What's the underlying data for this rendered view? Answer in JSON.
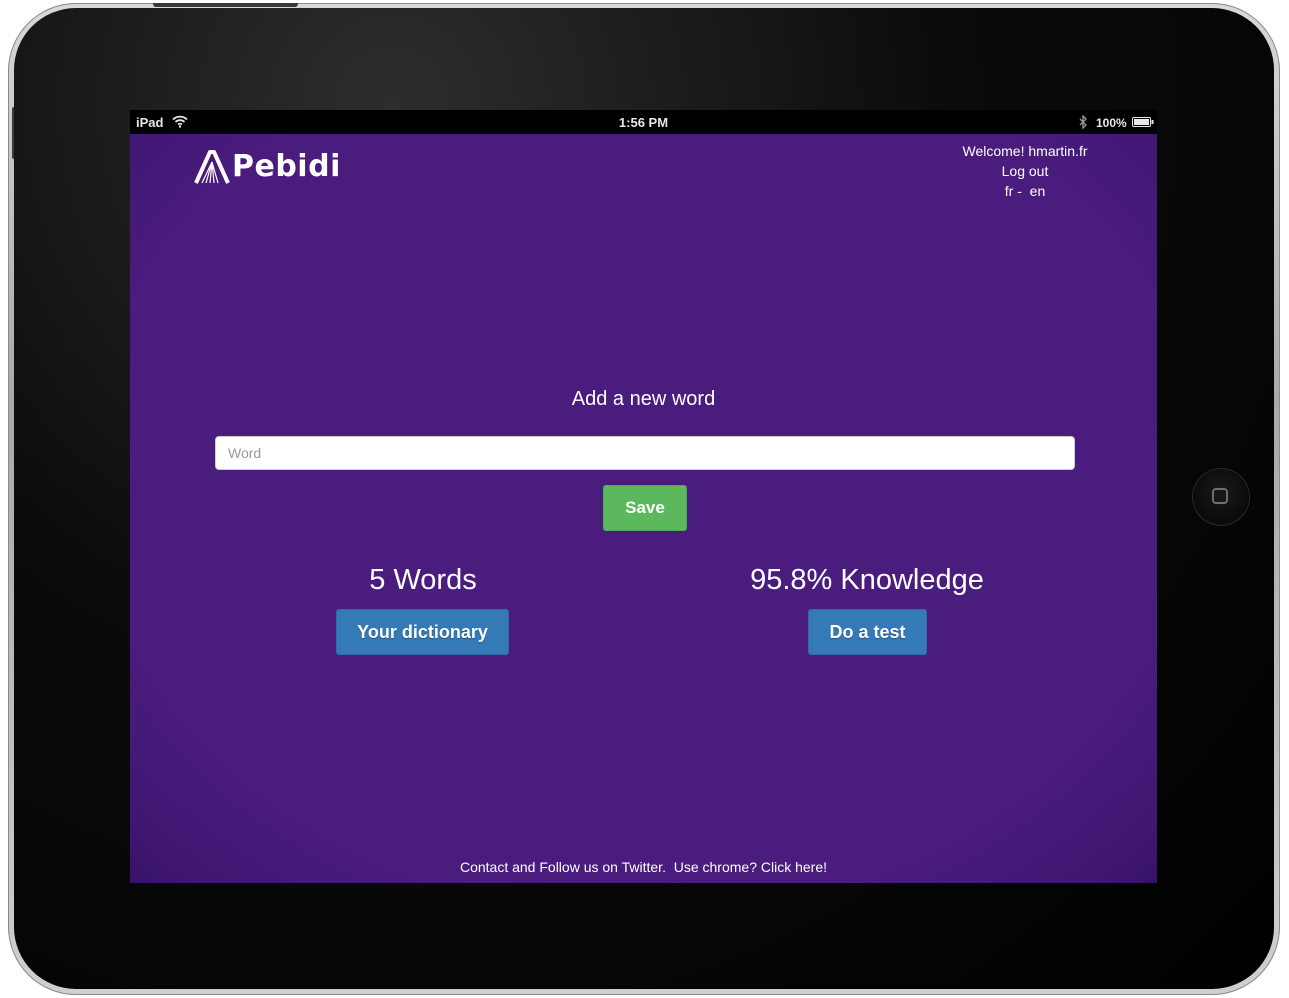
{
  "status_bar": {
    "device": "iPad",
    "time": "1:56 PM",
    "battery": "100%",
    "icons": [
      "wifi-icon",
      "bluetooth-icon",
      "battery-icon"
    ]
  },
  "header": {
    "logo_text": "Pebidi",
    "welcome": "Welcome! hmartin.fr",
    "logout": "Log out",
    "lang_fr": "fr",
    "lang_sep": " - ",
    "lang_en": "en"
  },
  "add_word": {
    "title": "Add a new word",
    "placeholder": "Word",
    "value": "",
    "save_label": "Save"
  },
  "stats": {
    "words": "5 Words",
    "dictionary_button": "Your dictionary",
    "knowledge": "95.8% Knowledge",
    "test_button": "Do a test"
  },
  "footer": {
    "contact": "Contact",
    "and_follow": " and Follow us on ",
    "twitter": "Twitter",
    "chrome_prompt": ".  Use chrome? ",
    "click_here": "Click here!"
  },
  "colors": {
    "background": "#4a1c7e",
    "save_button": "#5cb85c",
    "primary_button": "#337ab7",
    "text": "#ffffff"
  }
}
